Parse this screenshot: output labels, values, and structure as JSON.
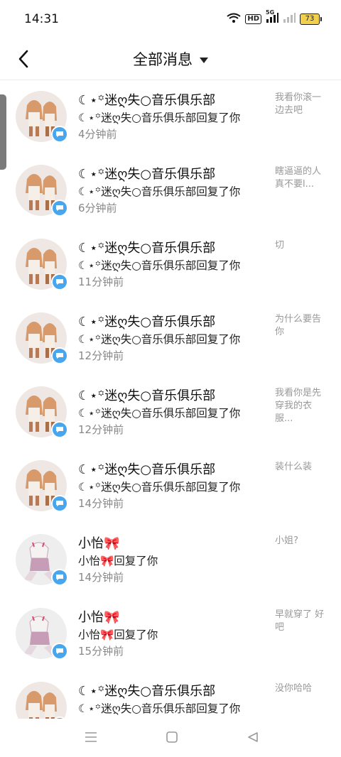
{
  "status": {
    "time": "14:31",
    "signal_label": "5G",
    "hd_label": "HD",
    "battery": "73"
  },
  "header": {
    "title": "全部消息"
  },
  "messages": [
    {
      "name": "☾⋆꙳迷ღ失○音乐俱乐部",
      "action": "☾⋆꙳迷ღ失○音乐俱乐部回复了你",
      "time": "4分钟前",
      "preview": "我看你滚一边去吧",
      "avatar": "club"
    },
    {
      "name": "☾⋆꙳迷ღ失○音乐俱乐部",
      "action": "☾⋆꙳迷ღ失○音乐俱乐部回复了你",
      "time": "6分钟前",
      "preview": "瞎逼逼的人真不要l...",
      "avatar": "club"
    },
    {
      "name": "☾⋆꙳迷ღ失○音乐俱乐部",
      "action": "☾⋆꙳迷ღ失○音乐俱乐部回复了你",
      "time": "11分钟前",
      "preview": "切",
      "avatar": "club"
    },
    {
      "name": "☾⋆꙳迷ღ失○音乐俱乐部",
      "action": "☾⋆꙳迷ღ失○音乐俱乐部回复了你",
      "time": "12分钟前",
      "preview": "为什么要告你",
      "avatar": "club"
    },
    {
      "name": "☾⋆꙳迷ღ失○音乐俱乐部",
      "action": "☾⋆꙳迷ღ失○音乐俱乐部回复了你",
      "time": "12分钟前",
      "preview": "我看你是先穿我的衣服...",
      "avatar": "club"
    },
    {
      "name": "☾⋆꙳迷ღ失○音乐俱乐部",
      "action": "☾⋆꙳迷ღ失○音乐俱乐部回复了你",
      "time": "14分钟前",
      "preview": "装什么装",
      "avatar": "club"
    },
    {
      "name": "小怡🎀",
      "action": "小怡🎀回复了你",
      "time": "14分钟前",
      "preview": "小姐?",
      "avatar": "girl"
    },
    {
      "name": "小怡🎀",
      "action": "小怡🎀回复了你",
      "time": "15分钟前",
      "preview": "早就穿了 好吧",
      "avatar": "girl"
    },
    {
      "name": "☾⋆꙳迷ღ失○音乐俱乐部",
      "action": "☾⋆꙳迷ღ失○音乐俱乐部回复了你",
      "time": "",
      "preview": "没你哈哈",
      "avatar": "club"
    }
  ],
  "colors": {
    "badge": "#48a6ee",
    "time": "#888888",
    "preview": "#999999"
  },
  "icons": {
    "back": "back-arrow-icon",
    "dropdown": "caret-down-icon",
    "badge": "comment-icon",
    "nav": [
      "menu-icon",
      "home-square-icon",
      "back-triangle-icon"
    ]
  }
}
